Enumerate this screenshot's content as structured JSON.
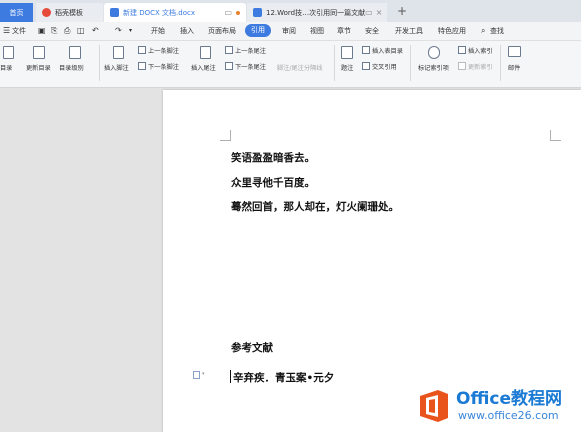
{
  "tabs": [
    {
      "label": "首页",
      "active": true
    },
    {
      "label": "稻壳模板"
    },
    {
      "label": "新建 DOCX 文档.docx"
    },
    {
      "label": "12.Word技…次引用同一篇文献"
    }
  ],
  "new_tab": "+",
  "menu": {
    "file": "文件",
    "items": [
      "开始",
      "插入",
      "页面布局",
      "引用",
      "审阅",
      "视图",
      "章节",
      "安全",
      "开发工具",
      "特色应用"
    ],
    "active": "引用",
    "search": "查找"
  },
  "ribbon": {
    "toc": "目录",
    "update_toc": "更新目录",
    "toc_level": "目录级别",
    "insert_footnote": "插入脚注",
    "prev_footnote": "上一条脚注",
    "next_footnote": "下一条脚注",
    "insert_endnote": "插入尾注",
    "prev_endnote": "上一条尾注",
    "next_endnote": "下一条尾注",
    "footnote_sep": "脚注/尾注分隔线",
    "caption": "题注",
    "insert_table_of_figures": "插入表目录",
    "cross_reference": "交叉引用",
    "mark_index": "标记索引项",
    "insert_index": "插入索引",
    "update_index": "更新索引",
    "mail": "邮件"
  },
  "document": {
    "lines": [
      "笑语盈盈暗香去。",
      "众里寻他千百度。",
      "蓦然回首，那人却在，灯火阑珊处。"
    ],
    "ref_heading": "参考文献",
    "ref_entry": "辛弃疾．青玉案•元夕"
  },
  "watermark": {
    "title": "Office教程网",
    "url": "www.office26.com"
  },
  "colors": {
    "accent": "#3d7be0",
    "ribbon_bg": "#f5f6f7",
    "logo_orange": "#e8541c"
  }
}
